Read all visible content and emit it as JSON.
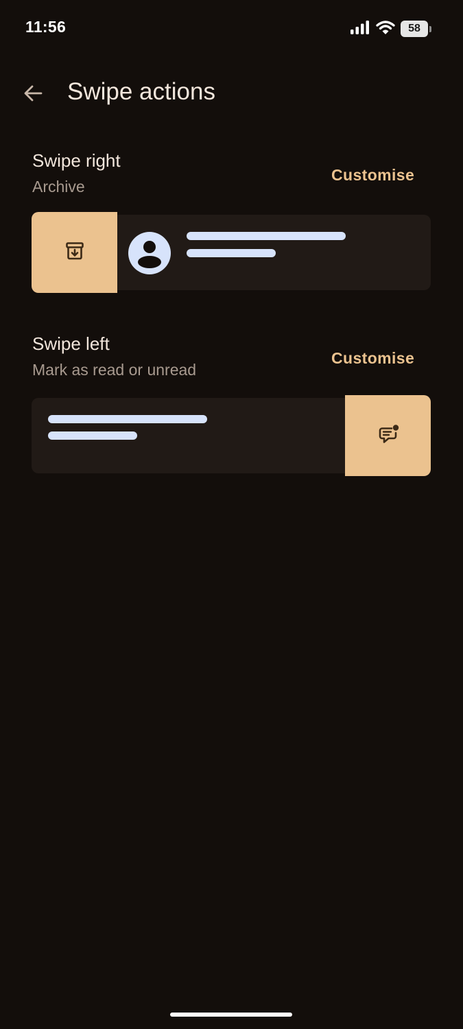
{
  "status_bar": {
    "time": "11:56",
    "battery_level": "58",
    "icons": [
      "cellular-signal-icon",
      "wifi-icon",
      "battery-icon"
    ]
  },
  "header": {
    "title": "Swipe actions",
    "back_icon": "arrow-back-icon"
  },
  "swipe_right": {
    "title": "Swipe right",
    "action": "Archive",
    "customise_label": "Customise",
    "action_icon": "archive-icon"
  },
  "swipe_left": {
    "title": "Swipe left",
    "action": "Mark as read or unread",
    "customise_label": "Customise",
    "action_icon": "mark-unread-chat-icon"
  },
  "colors": {
    "background": "#130e0b",
    "accent": "#ebc28f",
    "card": "#211a16",
    "placeholder": "#d7e3fb"
  }
}
